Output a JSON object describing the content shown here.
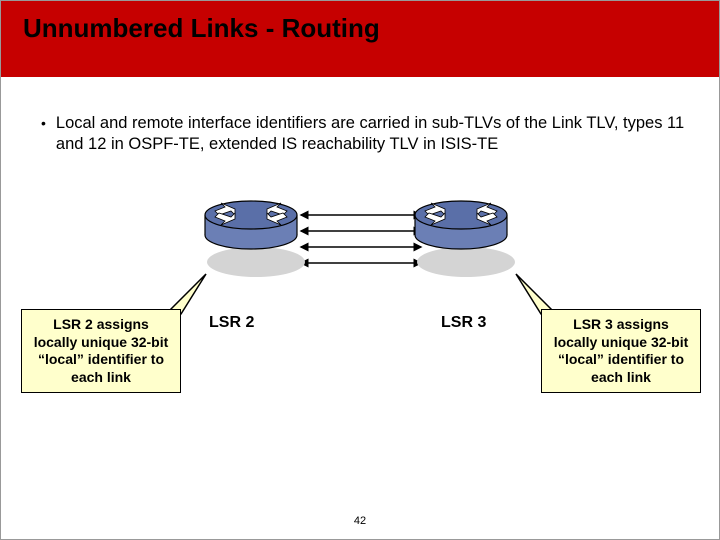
{
  "title": "Unnumbered Links - Routing",
  "bullet": "Local and remote interface identifiers are carried in sub-TLVs of the Link TLV, types 11 and 12 in OSPF-TE, extended IS reachability TLV in ISIS-TE",
  "router_left_label": "LSR 2",
  "router_right_label": "LSR 3",
  "callout_left": "LSR 2 assigns locally unique 32-bit “local” identifier to each link",
  "callout_right": "LSR 3 assigns locally unique 32-bit “local” identifier to each link",
  "page_number": "42"
}
